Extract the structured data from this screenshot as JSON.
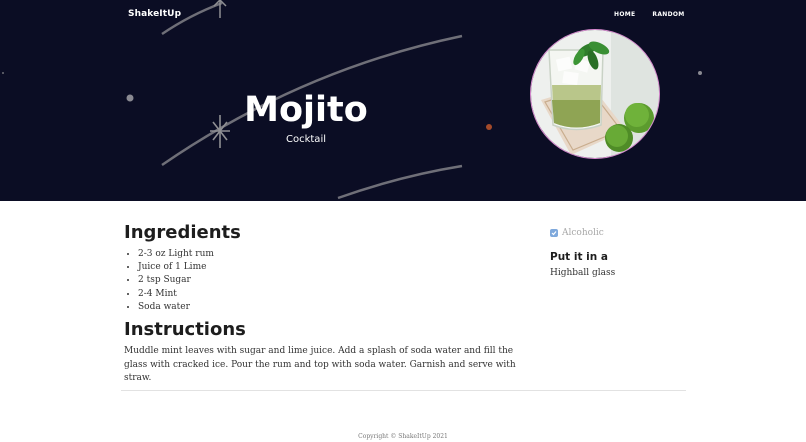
{
  "header": {
    "brand": "ShakeItUp",
    "nav": [
      {
        "label": "HOME"
      },
      {
        "label": "RANDOM"
      }
    ]
  },
  "hero": {
    "title": "Mojito",
    "category": "Cocktail",
    "image_icon": "mojito-photo"
  },
  "ingredients": {
    "heading": "Ingredients",
    "items": [
      "2-3 oz Light rum",
      "Juice of 1 Lime",
      "2 tsp Sugar",
      "2-4 Mint",
      "Soda water"
    ]
  },
  "instructions": {
    "heading": "Instructions",
    "text": "Muddle mint leaves with sugar and lime juice. Add a splash of soda water and fill the glass with cracked ice. Pour the rum and top with soda water. Garnish and serve with straw."
  },
  "sidebar": {
    "alcoholic_label": "Alcoholic",
    "alcoholic_checked": true,
    "glass_heading": "Put it in a",
    "glass_value": "Highball glass"
  },
  "footer": {
    "copyright": "Copyright © ShakeItUp 2021"
  },
  "colors": {
    "hero_background": "#0b0d24",
    "checkbox": "#7fa9dc",
    "photo_border": "#d98ad0"
  }
}
